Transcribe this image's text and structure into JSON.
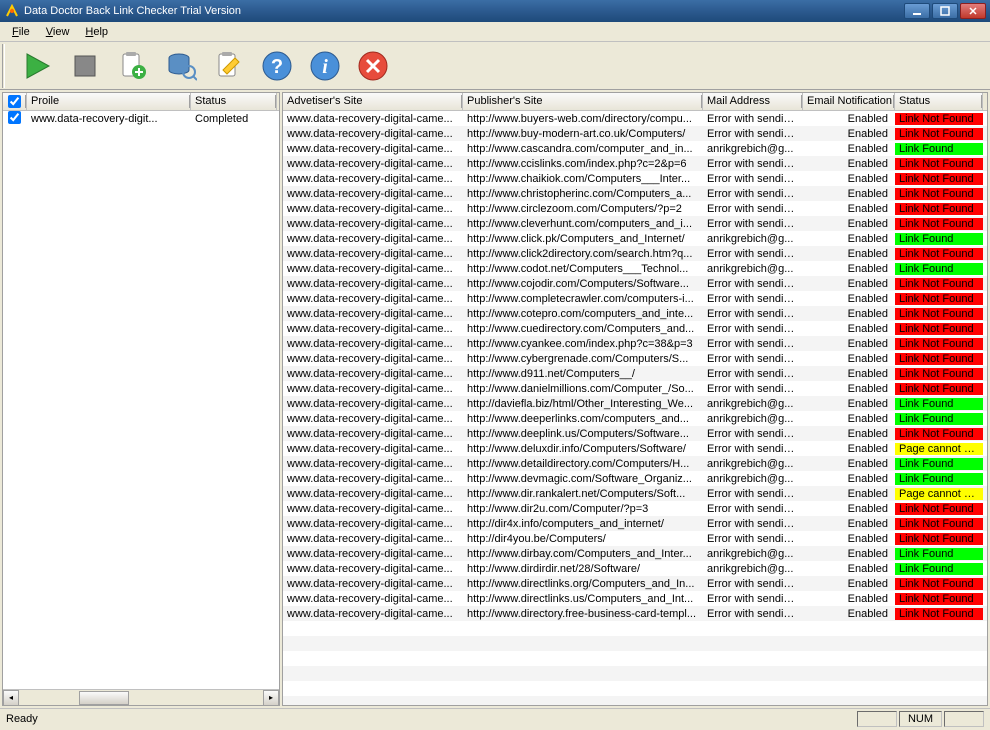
{
  "title": "Data Doctor Back Link Checker Trial Version",
  "menu": {
    "file": "File",
    "view": "View",
    "help": "Help"
  },
  "left": {
    "headers": {
      "profile": "Proile",
      "status": "Status"
    },
    "rows": [
      {
        "checked": true,
        "profile": "www.data-recovery-digit...",
        "status": "Completed"
      }
    ]
  },
  "right": {
    "headers": {
      "advertiser": "Advetiser's Site",
      "publisher": "Publisher's Site",
      "mail": "Mail Address",
      "notif": "Email Notification",
      "status": "Status"
    },
    "notif_enabled": "Enabled",
    "status_labels": {
      "lnf": "Link Not Found",
      "lf": "Link Found",
      "pc": "Page cannot be ..."
    },
    "rows": [
      {
        "adv": "www.data-recovery-digital-came...",
        "pub": "http://www.buyers-web.com/directory/compu...",
        "mail": "Error with sending...",
        "status": "lnf"
      },
      {
        "adv": "www.data-recovery-digital-came...",
        "pub": "http://www.buy-modern-art.co.uk/Computers/",
        "mail": "Error with sending...",
        "status": "lnf"
      },
      {
        "adv": "www.data-recovery-digital-came...",
        "pub": "http://www.cascandra.com/computer_and_in...",
        "mail": "anrikgrebich@g...",
        "status": "lf"
      },
      {
        "adv": "www.data-recovery-digital-came...",
        "pub": "http://www.ccislinks.com/index.php?c=2&p=6",
        "mail": "Error with sending...",
        "status": "lnf"
      },
      {
        "adv": "www.data-recovery-digital-came...",
        "pub": "http://www.chaikiok.com/Computers___Inter...",
        "mail": "Error with sending...",
        "status": "lnf"
      },
      {
        "adv": "www.data-recovery-digital-came...",
        "pub": "http://www.christopherinc.com/Computers_a...",
        "mail": "Error with sending...",
        "status": "lnf"
      },
      {
        "adv": "www.data-recovery-digital-came...",
        "pub": "http://www.circlezoom.com/Computers/?p=2",
        "mail": "Error with sending...",
        "status": "lnf"
      },
      {
        "adv": "www.data-recovery-digital-came...",
        "pub": "http://www.cleverhunt.com/computers_and_i...",
        "mail": "Error with sending...",
        "status": "lnf"
      },
      {
        "adv": "www.data-recovery-digital-came...",
        "pub": "http://www.click.pk/Computers_and_Internet/",
        "mail": "anrikgrebich@g...",
        "status": "lf"
      },
      {
        "adv": "www.data-recovery-digital-came...",
        "pub": "http://www.click2directory.com/search.htm?q...",
        "mail": "Error with sending...",
        "status": "lnf"
      },
      {
        "adv": "www.data-recovery-digital-came...",
        "pub": "http://www.codot.net/Computers___Technol...",
        "mail": "anrikgrebich@g...",
        "status": "lf"
      },
      {
        "adv": "www.data-recovery-digital-came...",
        "pub": "http://www.cojodir.com/Computers/Software...",
        "mail": "Error with sending...",
        "status": "lnf"
      },
      {
        "adv": "www.data-recovery-digital-came...",
        "pub": "http://www.completecrawler.com/computers-i...",
        "mail": "Error with sending...",
        "status": "lnf"
      },
      {
        "adv": "www.data-recovery-digital-came...",
        "pub": "http://www.cotepro.com/computers_and_inte...",
        "mail": "Error with sending...",
        "status": "lnf"
      },
      {
        "adv": "www.data-recovery-digital-came...",
        "pub": "http://www.cuedirectory.com/Computers_and...",
        "mail": "Error with sending...",
        "status": "lnf"
      },
      {
        "adv": "www.data-recovery-digital-came...",
        "pub": "http://www.cyankee.com/index.php?c=38&p=3",
        "mail": "Error with sending...",
        "status": "lnf"
      },
      {
        "adv": "www.data-recovery-digital-came...",
        "pub": "http://www.cybergrenade.com/Computers/S...",
        "mail": "Error with sending...",
        "status": "lnf"
      },
      {
        "adv": "www.data-recovery-digital-came...",
        "pub": "http://www.d911.net/Computers__/",
        "mail": "Error with sending...",
        "status": "lnf"
      },
      {
        "adv": "www.data-recovery-digital-came...",
        "pub": "http://www.danielmillions.com/Computer_/So...",
        "mail": "Error with sending...",
        "status": "lnf"
      },
      {
        "adv": "www.data-recovery-digital-came...",
        "pub": "http://daviefla.biz/html/Other_Interesting_We...",
        "mail": "anrikgrebich@g...",
        "status": "lf"
      },
      {
        "adv": "www.data-recovery-digital-came...",
        "pub": "http://www.deeperlinks.com/computers_and...",
        "mail": "anrikgrebich@g...",
        "status": "lf"
      },
      {
        "adv": "www.data-recovery-digital-came...",
        "pub": "http://www.deeplink.us/Computers/Software...",
        "mail": "Error with sending...",
        "status": "lnf"
      },
      {
        "adv": "www.data-recovery-digital-came...",
        "pub": "http://www.deluxdir.info/Computers/Software/",
        "mail": "Error with sending...",
        "status": "pc"
      },
      {
        "adv": "www.data-recovery-digital-came...",
        "pub": "http://www.detaildirectory.com/Computers/H...",
        "mail": "anrikgrebich@g...",
        "status": "lf"
      },
      {
        "adv": "www.data-recovery-digital-came...",
        "pub": "http://www.devmagic.com/Software_Organiz...",
        "mail": "anrikgrebich@g...",
        "status": "lf"
      },
      {
        "adv": "www.data-recovery-digital-came...",
        "pub": "http://www.dir.rankalert.net/Computers/Soft...",
        "mail": "Error with sending...",
        "status": "pc"
      },
      {
        "adv": "www.data-recovery-digital-came...",
        "pub": "http://www.dir2u.com/Computer/?p=3",
        "mail": "Error with sending...",
        "status": "lnf"
      },
      {
        "adv": "www.data-recovery-digital-came...",
        "pub": "http://dir4x.info/computers_and_internet/",
        "mail": "Error with sending...",
        "status": "lnf"
      },
      {
        "adv": "www.data-recovery-digital-came...",
        "pub": "http://dir4you.be/Computers/",
        "mail": "Error with sending...",
        "status": "lnf"
      },
      {
        "adv": "www.data-recovery-digital-came...",
        "pub": "http://www.dirbay.com/Computers_and_Inter...",
        "mail": "anrikgrebich@g...",
        "status": "lf"
      },
      {
        "adv": "www.data-recovery-digital-came...",
        "pub": "http://www.dirdirdir.net/28/Software/",
        "mail": "anrikgrebich@g...",
        "status": "lf"
      },
      {
        "adv": "www.data-recovery-digital-came...",
        "pub": "http://www.directlinks.org/Computers_and_In...",
        "mail": "Error with sending...",
        "status": "lnf"
      },
      {
        "adv": "www.data-recovery-digital-came...",
        "pub": "http://www.directlinks.us/Computers_and_Int...",
        "mail": "Error with sending...",
        "status": "lnf"
      },
      {
        "adv": "www.data-recovery-digital-came...",
        "pub": "http://www.directory.free-business-card-templ...",
        "mail": "Error with sending...",
        "status": "lnf"
      }
    ]
  },
  "statusbar": {
    "ready": "Ready",
    "num": "NUM"
  }
}
